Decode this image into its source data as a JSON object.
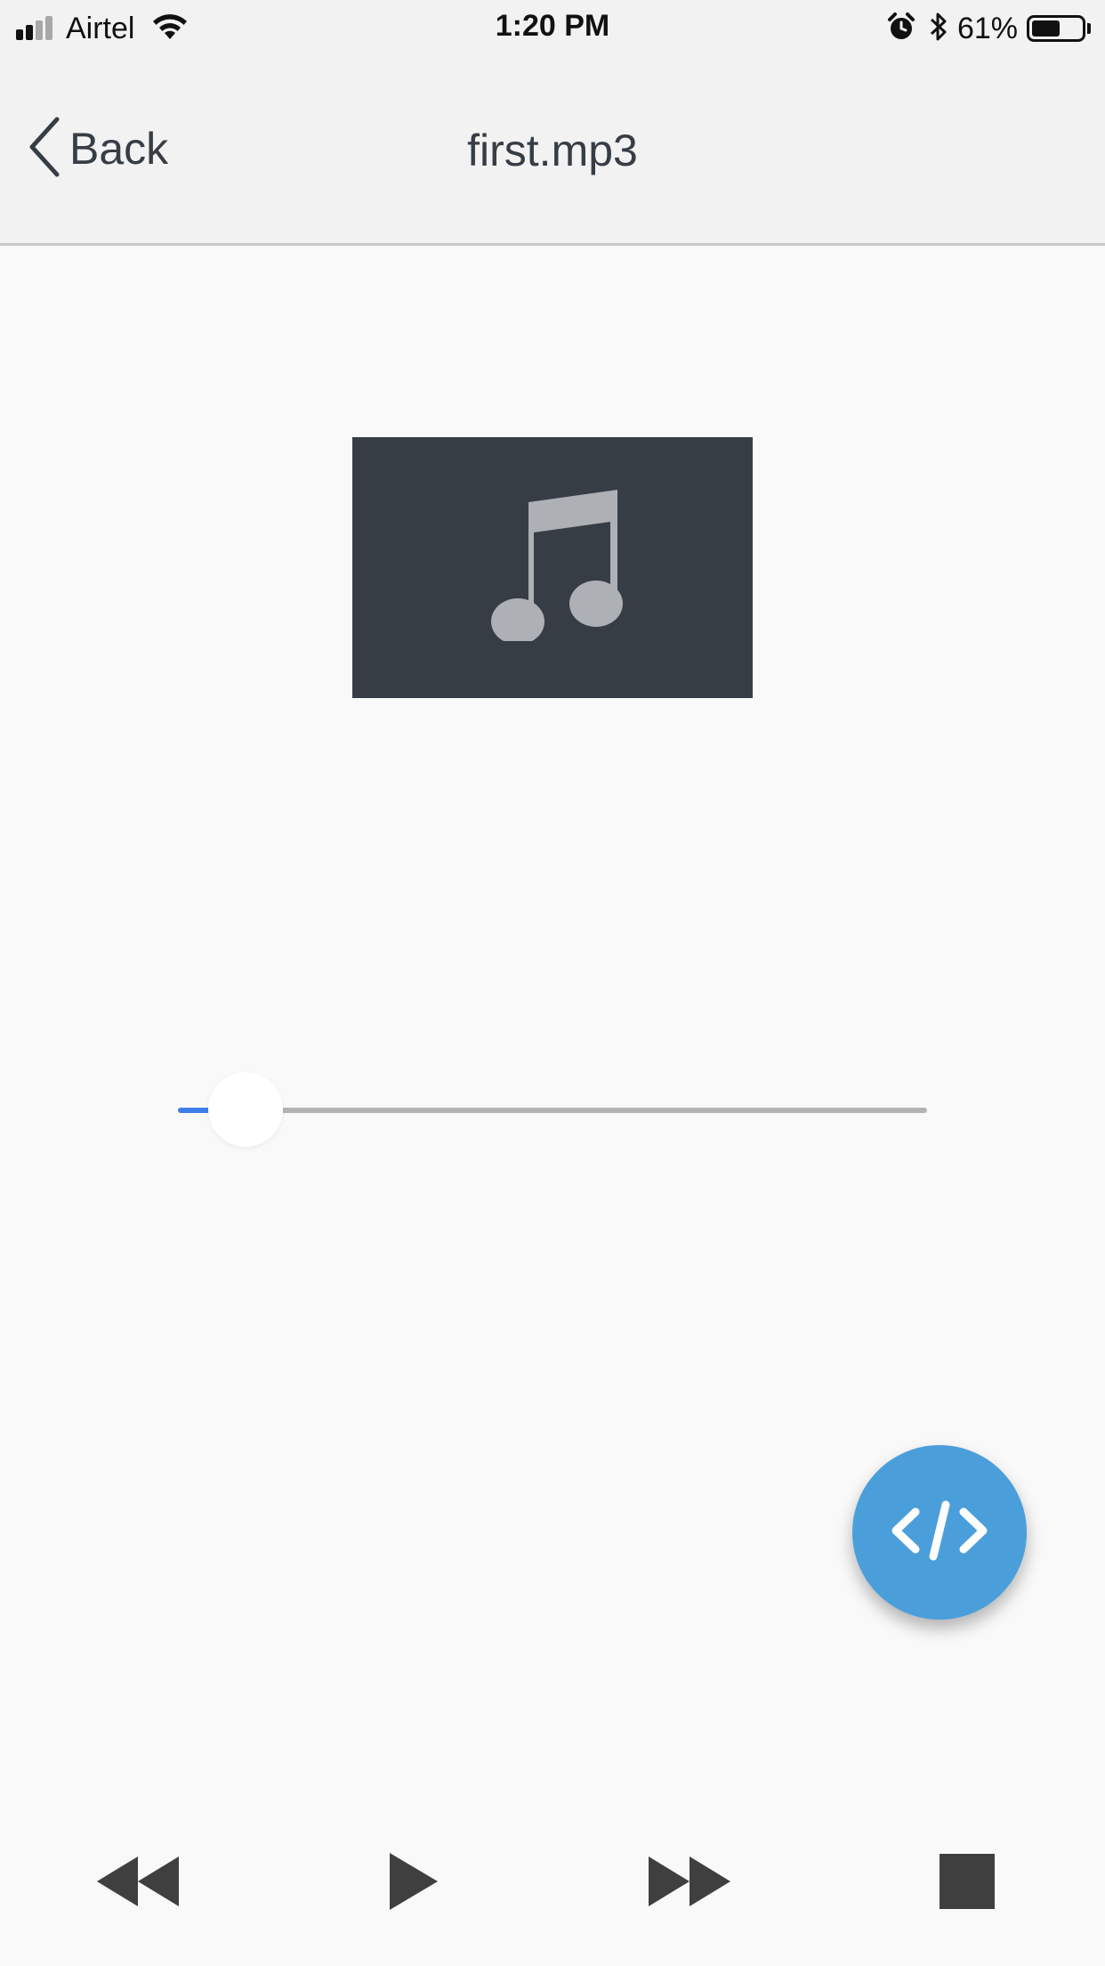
{
  "status_bar": {
    "carrier": "Airtel",
    "time": "1:20 PM",
    "battery_percent": "61%",
    "battery_level": 0.61,
    "icons": [
      "signal-icon",
      "wifi-icon",
      "alarm-icon",
      "bluetooth-icon",
      "battery-icon"
    ]
  },
  "nav": {
    "back_label": "Back",
    "title": "first.mp3"
  },
  "artwork": {
    "icon": "music-note-icon",
    "background": "#373d45",
    "icon_color": "#adb0b5"
  },
  "seek": {
    "progress": 0.09,
    "track_color": "#b3b3b3",
    "fill_color": "#3f7ee8"
  },
  "fab": {
    "icon": "code-icon",
    "color": "#4a9fdb"
  },
  "controls": [
    {
      "icon": "rewind-icon"
    },
    {
      "icon": "play-icon"
    },
    {
      "icon": "fast-forward-icon"
    },
    {
      "icon": "stop-icon"
    }
  ]
}
